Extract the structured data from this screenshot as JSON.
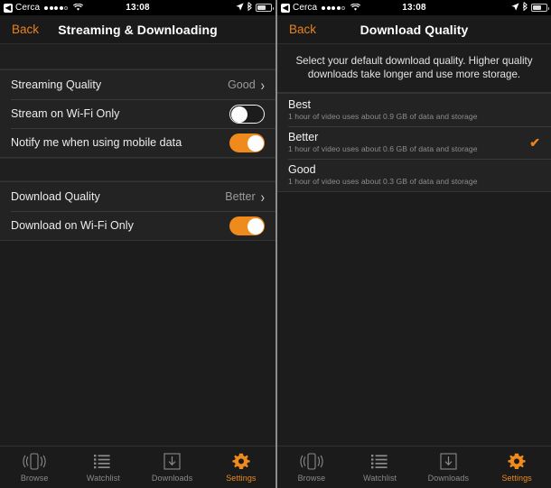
{
  "statusbar": {
    "back_glyph": "◀",
    "carrier": "Cerca",
    "time": "13:08",
    "signal_dots": 5,
    "signal_filled": 4,
    "wifi_icon": "wifi-icon",
    "location_icon": "location-arrow-icon",
    "bluetooth_icon": "bluetooth-icon",
    "battery_icon": "battery-icon"
  },
  "left_screen": {
    "nav": {
      "back_label": "Back",
      "title": "Streaming & Downloading"
    },
    "group_one": [
      {
        "label": "Streaming Quality",
        "type": "disclosure",
        "value": "Good",
        "chevron": "›"
      },
      {
        "label": "Stream on Wi-Fi Only",
        "type": "toggle",
        "state": "off"
      },
      {
        "label": "Notify me when using mobile data",
        "type": "toggle",
        "state": "on"
      }
    ],
    "group_two": [
      {
        "label": "Download Quality",
        "type": "disclosure",
        "value": "Better",
        "chevron": "›"
      },
      {
        "label": "Download on Wi-Fi Only",
        "type": "toggle",
        "state": "on"
      }
    ]
  },
  "right_screen": {
    "nav": {
      "back_label": "Back",
      "title": "Download Quality"
    },
    "description": "Select your default download quality. Higher quality downloads take longer and use more storage.",
    "options": [
      {
        "title": "Best",
        "subtitle": "1 hour of video uses about 0.9 GB of data and storage",
        "selected": false,
        "check_glyph": "✔"
      },
      {
        "title": "Better",
        "subtitle": "1 hour of video uses about 0.6 GB of data and storage",
        "selected": true,
        "check_glyph": "✔"
      },
      {
        "title": "Good",
        "subtitle": "1 hour of video uses about 0.3 GB of data and storage",
        "selected": false,
        "check_glyph": "✔"
      }
    ]
  },
  "tabbar": {
    "items": [
      {
        "label": "Browse",
        "icon": "browse-device-icon",
        "active": false
      },
      {
        "label": "Watchlist",
        "icon": "list-icon",
        "active": false
      },
      {
        "label": "Downloads",
        "icon": "download-box-icon",
        "active": false
      },
      {
        "label": "Settings",
        "icon": "gear-icon",
        "active": true
      }
    ]
  },
  "colors": {
    "accent": "#ef8b1c",
    "accent_text": "#e8821e",
    "background": "#1c1c1c",
    "row_background": "#232323",
    "primary_text": "#f2f2f2",
    "secondary_text": "#8d8d8d"
  }
}
